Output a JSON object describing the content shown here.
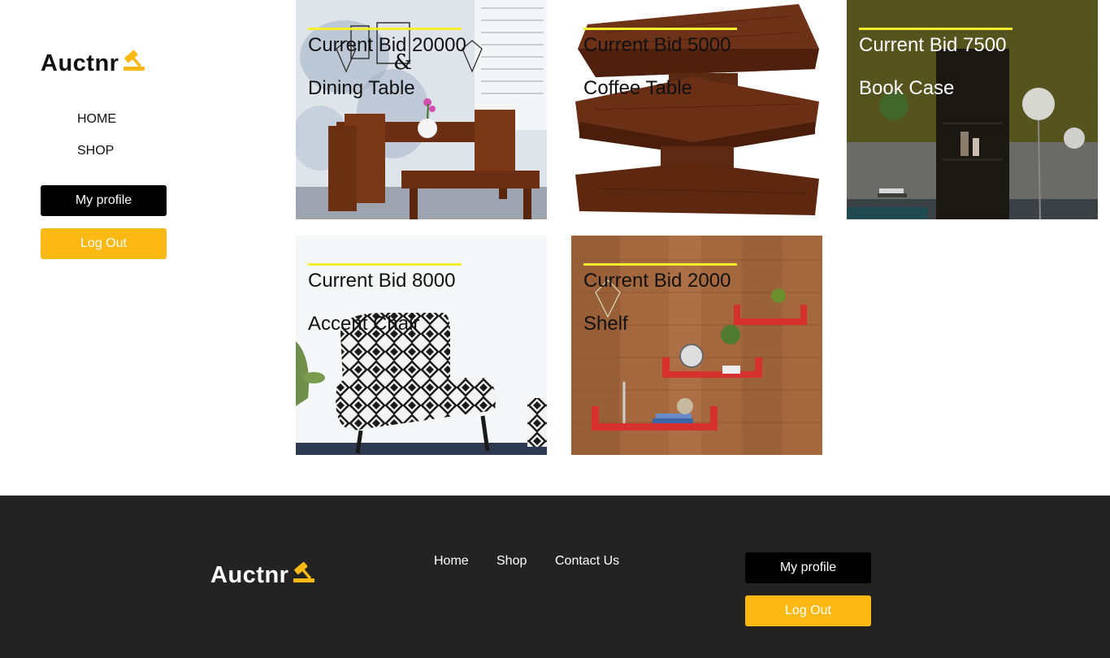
{
  "brand": {
    "name": "Auctnr",
    "accent": "#fcb813"
  },
  "sidebar": {
    "nav": [
      {
        "label": "HOME"
      },
      {
        "label": "SHOP"
      }
    ],
    "profile_label": "My profile",
    "logout_label": "Log Out"
  },
  "products": [
    {
      "bid": "Current Bid 20000",
      "name": "Dining Table",
      "image": "dining-table-photo"
    },
    {
      "bid": "Current Bid 5000",
      "name": "Coffee Table",
      "image": "coffee-table-photo"
    },
    {
      "bid": "Current Bid 7500",
      "name": "Book Case",
      "image": "book-case-photo"
    },
    {
      "bid": "Current Bid 8000",
      "name": "Accent Chair",
      "image": "accent-chair-photo"
    },
    {
      "bid": "Current Bid 2000",
      "name": "Shelf",
      "image": "shelf-photo"
    }
  ],
  "footer": {
    "links": [
      {
        "label": "Home"
      },
      {
        "label": "Shop"
      },
      {
        "label": "Contact Us"
      }
    ],
    "profile_label": "My profile",
    "logout_label": "Log Out",
    "background": "#232323"
  },
  "colors": {
    "bid_rule": "#f5ee2c",
    "dark_button": "#000000"
  }
}
